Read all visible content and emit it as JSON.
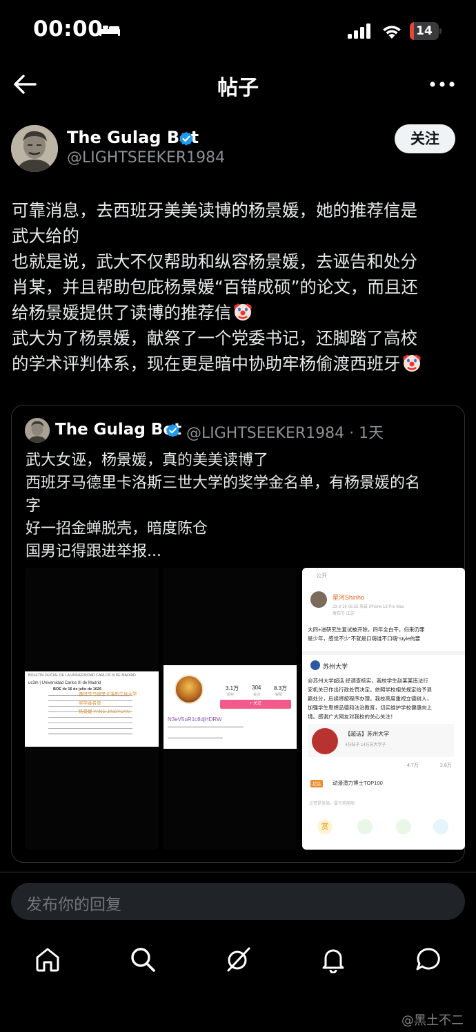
{
  "status_bar": {
    "time": "00:00",
    "battery": "14",
    "battery_level": 0.14
  },
  "nav": {
    "title": "帖子"
  },
  "post": {
    "author_name": "The Gulag Bot",
    "author_handle": "@LIGHTSEEKER1984",
    "follow_label": "关注",
    "lines": [
      "可靠消息，去西班牙美美读博的杨景媛，她的推荐信是",
      "武大给的",
      "也就是说，武大不仅帮助和纵容杨景媛，去诬告和处分",
      "肖某，并且帮助包庇杨景媛“百错成硕”的论文，而且还",
      "给杨景媛提供了读博的推荐信",
      "武大为了杨景媛，献祭了一个党委书记，还脚踏了高校",
      "的学术评判体系，现在更是暗中协助牢杨偷渡西班牙"
    ]
  },
  "quote": {
    "author_name": "The Gulag Bot",
    "meta": "@LIGHTSEEKER1984 · 1天",
    "lines": [
      "武大女诬，杨景媛，真的美美读博了",
      "西班牙马德里卡洛斯三世大学的奖学金名单，有杨景媛的名",
      "字",
      "好一招金蝉脱壳，暗度陈仓",
      "国男记得跟进举报..."
    ],
    "media1": {
      "header": "BOLETÍN OFICIAL DE LA UNIVERSIDAD CARLOS III DE MADRID",
      "uni": "uc3m | Universidad Carlos III de Madrid",
      "date": "BOE de 16 de julio de 1626",
      "note_cn": "西班牙马德里卡洛斯三世大学",
      "note2": "奖学金名单",
      "note3": "杨景媛 YANG JINGYUAN"
    },
    "media2": {
      "stats": [
        "3.1万",
        "304",
        "8.3万"
      ],
      "stat_labels": [
        "粉丝",
        "关注",
        "获赞"
      ],
      "follow": "+ 关注",
      "user": "N3eV5uR1c8djHDRW"
    },
    "media3": {
      "public": "公开",
      "user": "星河Shinho",
      "meta": "23-3-19 06:53 来自 iPhone 13 Pro Max",
      "location": "发布于 江苏",
      "text1": "大四+进研究生复试被开除，四年全白干，归来仍罪",
      "text2": "是少年，感觉不少\"不就是口嗨谁不口嗨\"style的要",
      "org": "苏州大学",
      "org_text": [
        "@苏州大学超话 经调查核实，我校学生赵某某违法行",
        "安机关已作出行政处罚决定。依照学校相关规定给予退",
        "籍处分，后续将按程序办理。我校高度重视立德树人，",
        "加强学生思想品德和法治教育，切实维护学校健康向上",
        "境。感谢广大网友对我校的关心关注！"
      ],
      "super": "【超话】苏州大学",
      "super_meta": "4万帖子 14万苏大学子",
      "counts": [
        "4.7万",
        "2.8万"
      ],
      "tag": "动漫潜力博士TOP100",
      "tag_label": "超话",
      "comment": "点赞是美德，要写笔随随"
    }
  },
  "reply": {
    "placeholder": "发布你的回复"
  },
  "watermark": "@黑土不二",
  "colors": {
    "verified": "#1d9bf0",
    "background": "#000000",
    "accent": "#e5453a"
  }
}
